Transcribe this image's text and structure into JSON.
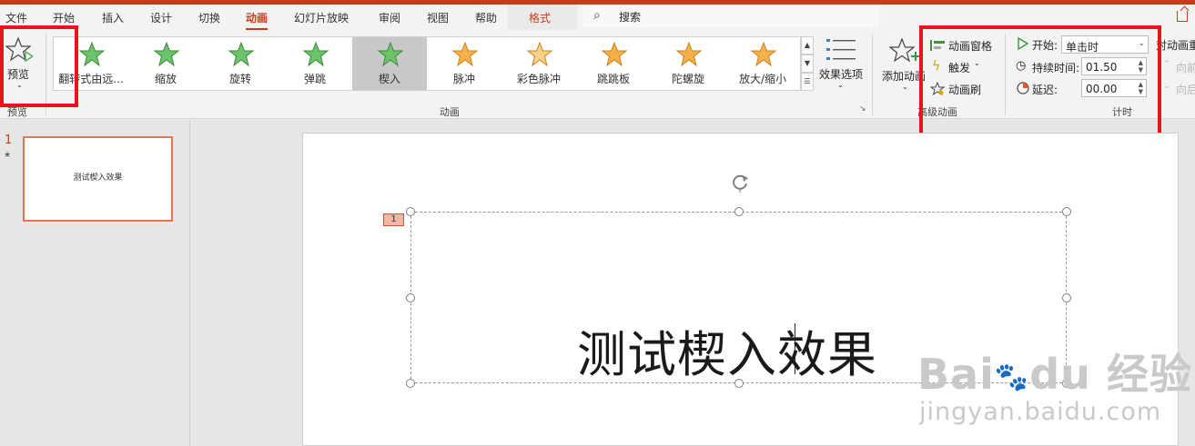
{
  "menu": {
    "tabs": [
      "文件",
      "开始",
      "插入",
      "设计",
      "切换",
      "动画",
      "幻灯片放映",
      "审阅",
      "视图",
      "帮助",
      "格式"
    ],
    "active": "动画",
    "search_label": "搜索"
  },
  "ribbon": {
    "preview": {
      "label": "预览",
      "group": "预览"
    },
    "gallery": {
      "items": [
        "翻转式由远...",
        "缩放",
        "旋转",
        "弹跳",
        "楔入",
        "脉冲",
        "彩色脉冲",
        "跳跳板",
        "陀螺旋",
        "放大/缩小"
      ],
      "selected": "楔入"
    },
    "effect_options": "效果选项",
    "animation_group": "动画",
    "add_animation": "添加动画",
    "advanced": {
      "pane": "动画窗格",
      "trigger": "触发",
      "painter": "动画刷",
      "group": "高级动画"
    },
    "timing": {
      "start_label": "开始:",
      "start_value": "单击时",
      "duration_label": "持续时间:",
      "duration_value": "01.50",
      "delay_label": "延迟:",
      "delay_value": "00.00",
      "group": "计时"
    },
    "reorder": {
      "title": "对动画重",
      "earlier": "向前",
      "later": "向后"
    }
  },
  "slides": {
    "number": "1",
    "thumb_text": "测试楔入效果"
  },
  "slide": {
    "anim_tag": "1",
    "text": "测试楔入效果"
  },
  "watermark": {
    "brand": "Bai",
    "brand2": "du",
    "brand3": "经验",
    "url": "jingyan.baidu.com"
  },
  "colors": {
    "accent": "#c43e1c",
    "highlight": "#e8141b",
    "star_green": "#6cc36c",
    "star_orange": "#f4b04a"
  }
}
